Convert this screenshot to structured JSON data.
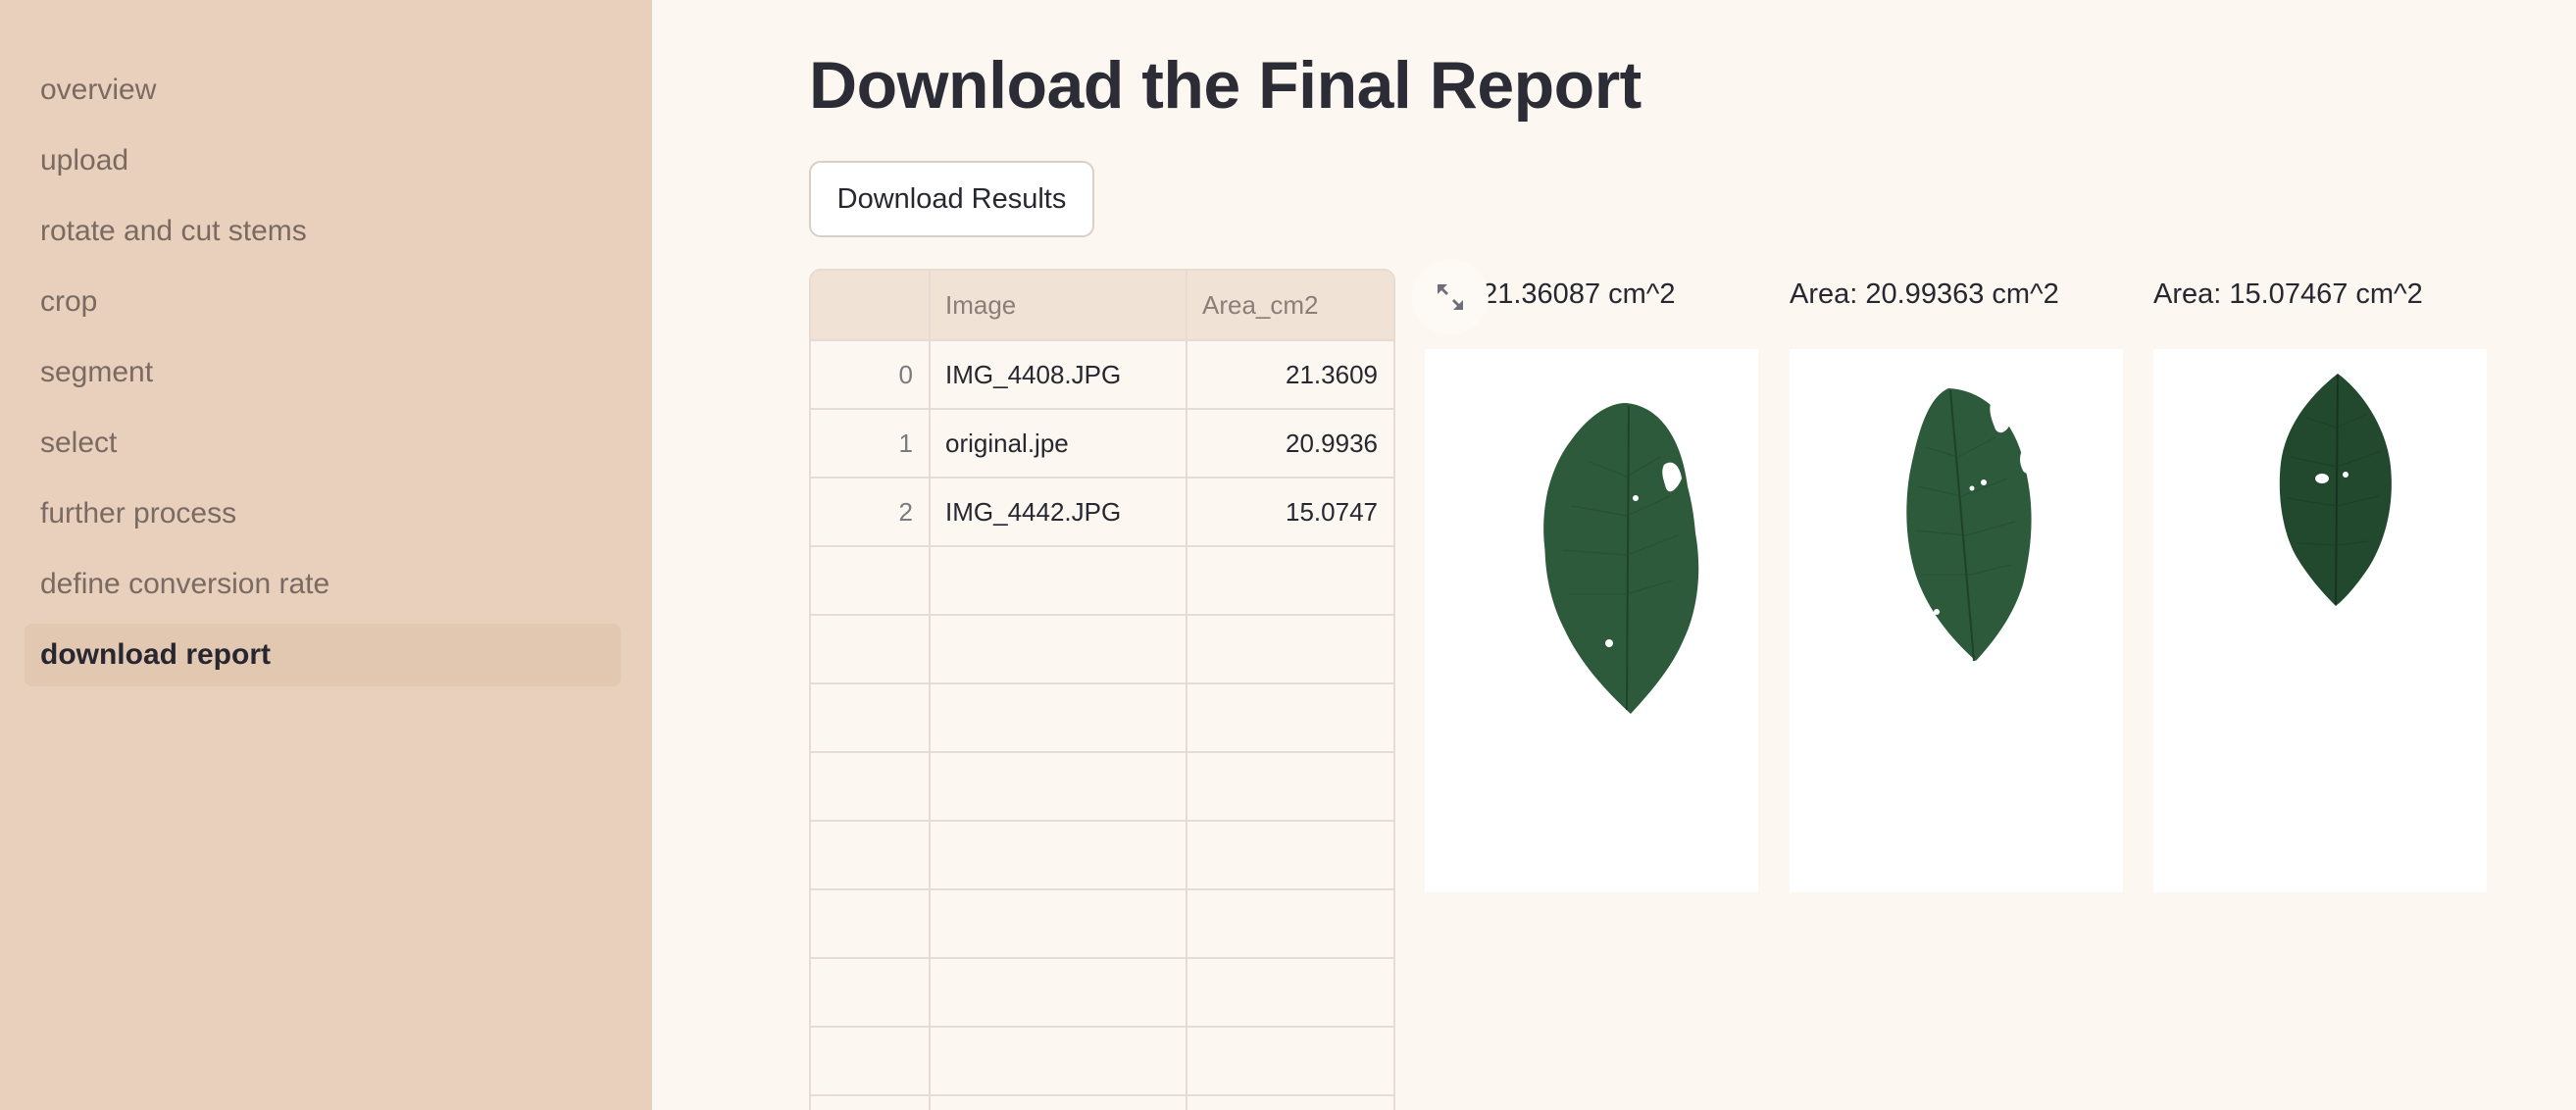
{
  "sidebar": {
    "items": [
      {
        "label": "overview"
      },
      {
        "label": "upload"
      },
      {
        "label": "rotate and cut stems"
      },
      {
        "label": "crop"
      },
      {
        "label": "segment"
      },
      {
        "label": "select"
      },
      {
        "label": "further process"
      },
      {
        "label": "define conversion rate"
      },
      {
        "label": "download report",
        "active": true
      }
    ]
  },
  "main": {
    "title": "Download the Final Report",
    "download_button": "Download Results",
    "table": {
      "columns": [
        "",
        "Image",
        "Area_cm2"
      ],
      "rows": [
        {
          "index": "0",
          "image": "IMG_4408.JPG",
          "area": "21.3609"
        },
        {
          "index": "1",
          "image": "original.jpe",
          "area": "20.9936"
        },
        {
          "index": "2",
          "image": "IMG_4442.JPG",
          "area": "15.0747"
        }
      ]
    },
    "gallery": [
      {
        "caption": ": 21.36087 cm^2"
      },
      {
        "caption": "Area: 20.99363 cm^2"
      },
      {
        "caption": "Area: 15.07467 cm^2"
      }
    ],
    "expand_icon": "expand-icon",
    "leaf_color": "#2d5a3a"
  }
}
